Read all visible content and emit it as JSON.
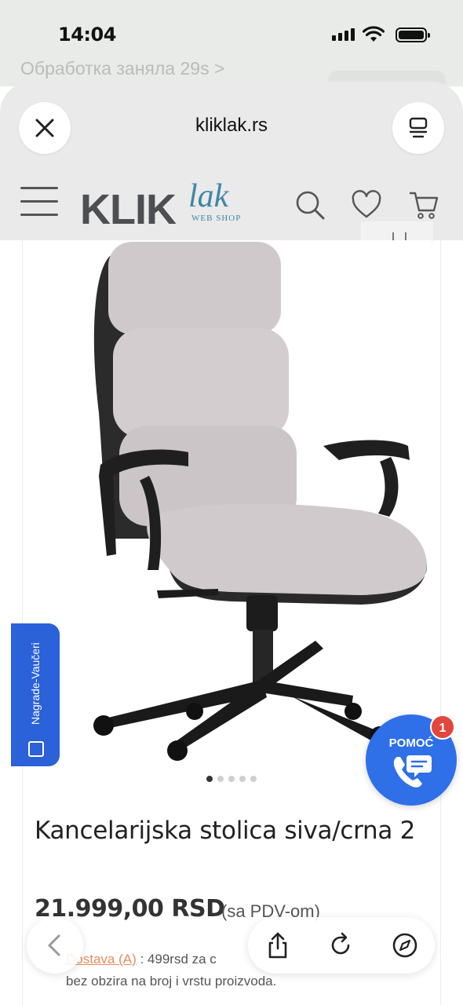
{
  "status_bar": {
    "time": "14:04"
  },
  "background_app": {
    "processing_text": "Обработка заняла 29s >"
  },
  "browser": {
    "domain": "kliklak.rs"
  },
  "site": {
    "logo": {
      "klik": "KLIK",
      "lak": "lak",
      "sub": "WEB SHOP"
    }
  },
  "gallery": {
    "slides": 5,
    "active_slide": 1
  },
  "rewards_tab": {
    "label": "Nagrade-Vaučeri"
  },
  "help_widget": {
    "label": "POMOĆ",
    "badge": "1"
  },
  "product": {
    "title": "Kancelarijska stolica siva/crna 2",
    "price": "21.999,00 RSD",
    "vat_note": "(sa PDV-om)",
    "delivery_link": "Dostava (A)",
    "delivery_text": ": 499rsd za c",
    "delivery_note": "bez obzira na broj i vrstu proizvoda."
  },
  "colors": {
    "brand_blue": "#3f86a6",
    "rewards_blue": "#2b61d9",
    "help_blue": "#2f6fe8",
    "badge_red": "#e2463c"
  }
}
